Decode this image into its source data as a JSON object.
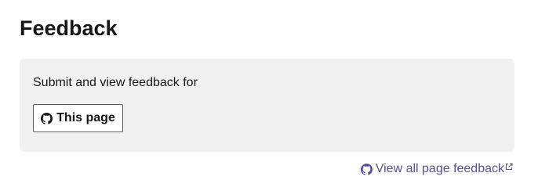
{
  "feedback": {
    "title": "Feedback",
    "panel_text": "Submit and view feedback for",
    "this_page_button": {
      "label": "This page",
      "icon": "github-icon"
    },
    "view_all_link": {
      "label": "View all page feedback",
      "icon": "github-icon",
      "trailing_icon": "external-link-icon"
    }
  },
  "colors": {
    "link": "#5c4d9e",
    "panel_background": "#f1f1f1",
    "text": "#171717"
  }
}
